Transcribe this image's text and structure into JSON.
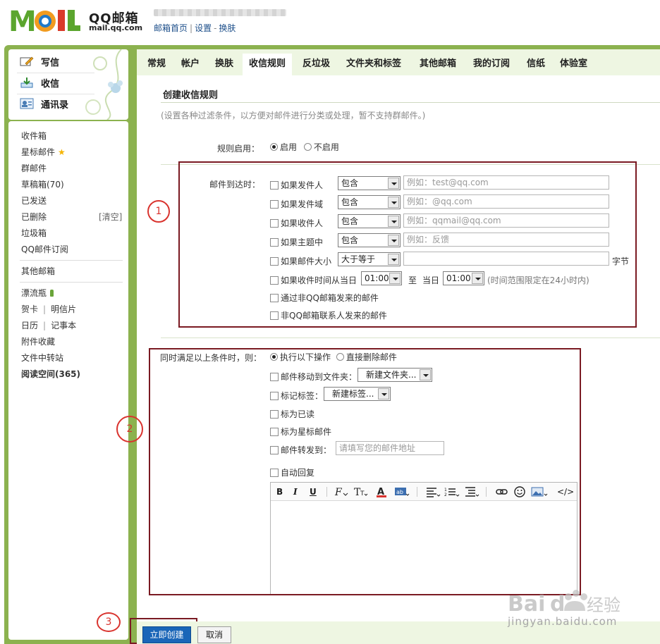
{
  "header": {
    "brand": "QQ邮箱",
    "domain": "mail.qq.com",
    "links": [
      "邮箱首页",
      "设置",
      "换肤"
    ]
  },
  "sidebar": {
    "quick": [
      {
        "label": "写信",
        "icon": "compose-icon"
      },
      {
        "label": "收信",
        "icon": "inbox-download-icon"
      },
      {
        "label": "通讯录",
        "icon": "contacts-icon"
      }
    ],
    "folders": [
      "收件箱",
      "星标邮件",
      "群邮件",
      "草稿箱(70)",
      "已发送",
      "已删除",
      "垃圾箱",
      "QQ邮件订阅"
    ],
    "clear_label": "[清空]",
    "other_mail": "其他邮箱",
    "apps": [
      "漂流瓶",
      "贺卡",
      "明信片",
      "日历",
      "记事本",
      "附件收藏",
      "文件中转站",
      "阅读空间(365)"
    ]
  },
  "tabs": [
    {
      "label": "常规",
      "active": false
    },
    {
      "label": "帐户",
      "active": false
    },
    {
      "label": "换肤",
      "active": false
    },
    {
      "label": "收信规则",
      "active": true
    },
    {
      "label": "反垃圾",
      "active": false
    },
    {
      "label": "文件夹和标签",
      "active": false
    },
    {
      "label": "其他邮箱",
      "active": false
    },
    {
      "label": "我的订阅",
      "active": false
    },
    {
      "label": "信纸",
      "active": false
    },
    {
      "label": "体验室",
      "active": false
    }
  ],
  "panel": {
    "title": "创建收信规则",
    "hint": "(设置各种过滤条件，以方便对邮件进行分类或处理，暂不支持群邮件。)",
    "rule_enable": {
      "label": "规则启用：",
      "options": [
        {
          "label": "启用",
          "selected": true
        },
        {
          "label": "不启用",
          "selected": false
        }
      ]
    },
    "conditions": {
      "label": "邮件到达时：",
      "rows": [
        {
          "label": "如果发件人",
          "op": "包含",
          "placeholder": "例如：test@qq.com"
        },
        {
          "label": "如果发件域",
          "op": "包含",
          "placeholder": "例如：@qq.com"
        },
        {
          "label": "如果收件人",
          "op": "包含",
          "placeholder": "例如：qqmail@qq.com"
        },
        {
          "label": "如果主题中",
          "op": "包含",
          "placeholder": "例如：反馈"
        },
        {
          "label": "如果邮件大小",
          "op": "大于等于",
          "placeholder": "",
          "unit": "字节"
        }
      ],
      "time_row": {
        "label": "如果收件时间从当日",
        "from": "01:00",
        "to_label": "至",
        "day_label": "当日",
        "to": "01:00",
        "note": "(时间范围限定在24小时内)"
      },
      "extra": [
        "通过非QQ邮箱发来的邮件",
        "非QQ邮箱联系人发来的邮件"
      ]
    },
    "actions": {
      "label": "同时满足以上条件时，则：",
      "options": [
        {
          "label": "执行以下操作",
          "selected": true
        },
        {
          "label": "直接删除邮件",
          "selected": false
        }
      ],
      "move_label": "邮件移动到文件夹：",
      "move_value": "新建文件夹...",
      "tag_label": "标记标签：",
      "tag_value": "新建标签...",
      "mark_read": "标为已读",
      "mark_star": "标为星标邮件",
      "forward_label": "邮件转发到：",
      "forward_placeholder": "请填写您的邮件地址",
      "auto_reply": "自动回复"
    },
    "editor_tools": [
      "B",
      "I",
      "U",
      "</>"
    ]
  },
  "buttons": {
    "create": "立即创建",
    "cancel": "取消"
  },
  "annotations": [
    "1",
    "2",
    "3"
  ],
  "watermark": {
    "text": "jingyan.baidu.com"
  },
  "colors": {
    "frame": "#8cb24f",
    "tab_bg": "#eef6e2",
    "primary": "#1a66b8",
    "annot_box": "#7a1a22",
    "annot_circle": "#d9332e"
  }
}
